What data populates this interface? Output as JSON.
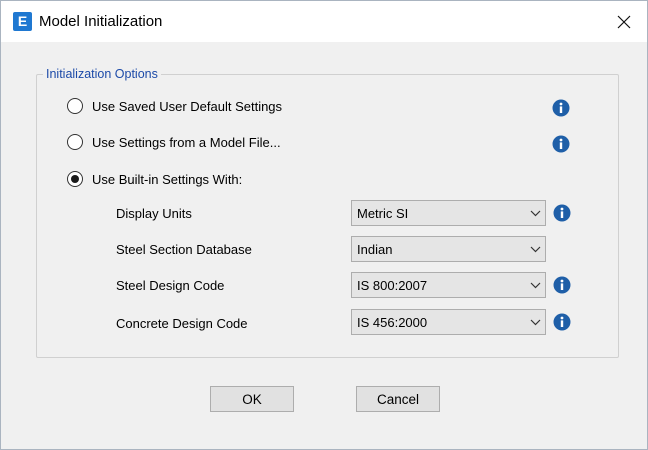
{
  "window": {
    "title": "Model Initialization",
    "app_icon_letter": "E"
  },
  "group": {
    "legend": "Initialization Options"
  },
  "options": [
    {
      "label": "Use Saved User Default Settings",
      "checked": false
    },
    {
      "label": "Use Settings from a Model File...",
      "checked": false
    },
    {
      "label": "Use Built-in Settings With:",
      "checked": true
    }
  ],
  "settings": {
    "display_units": {
      "label": "Display Units",
      "value": "Metric SI"
    },
    "steel_database": {
      "label": "Steel Section Database",
      "value": "Indian"
    },
    "steel_code": {
      "label": "Steel Design Code",
      "value": "IS 800:2007"
    },
    "concrete_code": {
      "label": "Concrete Design Code",
      "value": "IS 456:2000"
    }
  },
  "buttons": {
    "ok": "OK",
    "cancel": "Cancel"
  },
  "colors": {
    "info_icon": "#1f5fa8",
    "legend_text": "#1c4aa8",
    "app_icon": "#1f78d1"
  }
}
